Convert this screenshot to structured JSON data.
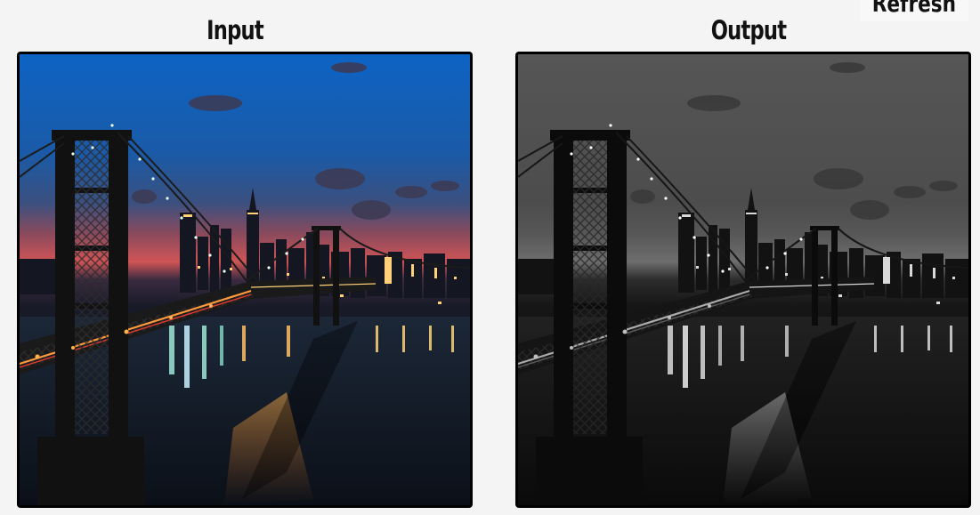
{
  "header": {
    "input_title": "Input",
    "output_title": "Output",
    "refresh_label": "Refresh"
  },
  "images": {
    "input_alt": "Input image",
    "output_alt": "Output image"
  }
}
